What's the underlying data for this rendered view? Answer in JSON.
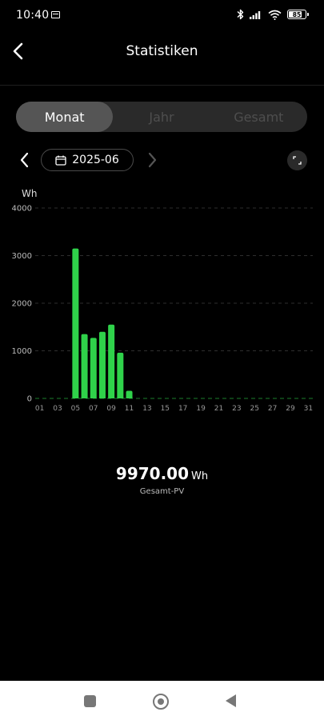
{
  "status_bar": {
    "time": "10:40",
    "battery": "85",
    "icons": [
      "calendar-icon",
      "bluetooth-icon",
      "signal-icon",
      "wifi-icon",
      "battery-icon"
    ]
  },
  "header": {
    "title": "Statistiken"
  },
  "tabs": [
    {
      "label": "Monat",
      "active": true
    },
    {
      "label": "Jahr",
      "active": false
    },
    {
      "label": "Gesamt",
      "active": false
    }
  ],
  "date_nav": {
    "date": "2025-06"
  },
  "chart_data": {
    "type": "bar",
    "ylabel": "Wh",
    "ylim": [
      0,
      4000
    ],
    "yticks": [
      0,
      1000,
      2000,
      3000,
      4000
    ],
    "grid": true,
    "bar_color": "#2fd24a",
    "categories": [
      "01",
      "02",
      "03",
      "04",
      "05",
      "06",
      "07",
      "08",
      "09",
      "10",
      "11",
      "12",
      "13",
      "14",
      "15",
      "16",
      "17",
      "18",
      "19",
      "20",
      "21",
      "22",
      "23",
      "24",
      "25",
      "26",
      "27",
      "28",
      "29",
      "30",
      "31"
    ],
    "tick_labels": [
      "01",
      "03",
      "05",
      "07",
      "09",
      "11",
      "13",
      "15",
      "17",
      "19",
      "21",
      "23",
      "25",
      "27",
      "29",
      "31"
    ],
    "values": [
      0,
      0,
      0,
      0,
      3150,
      1350,
      1270,
      1400,
      1550,
      960,
      160,
      0,
      0,
      0,
      0,
      0,
      0,
      0,
      0,
      0,
      0,
      0,
      0,
      0,
      0,
      0,
      0,
      0,
      0,
      0,
      0
    ]
  },
  "summary": {
    "value": "9970.00",
    "unit": "Wh",
    "label": "Gesamt-PV"
  },
  "colors": {
    "accent": "#2fd24a",
    "background": "#000000",
    "segment_active": "#555555"
  }
}
